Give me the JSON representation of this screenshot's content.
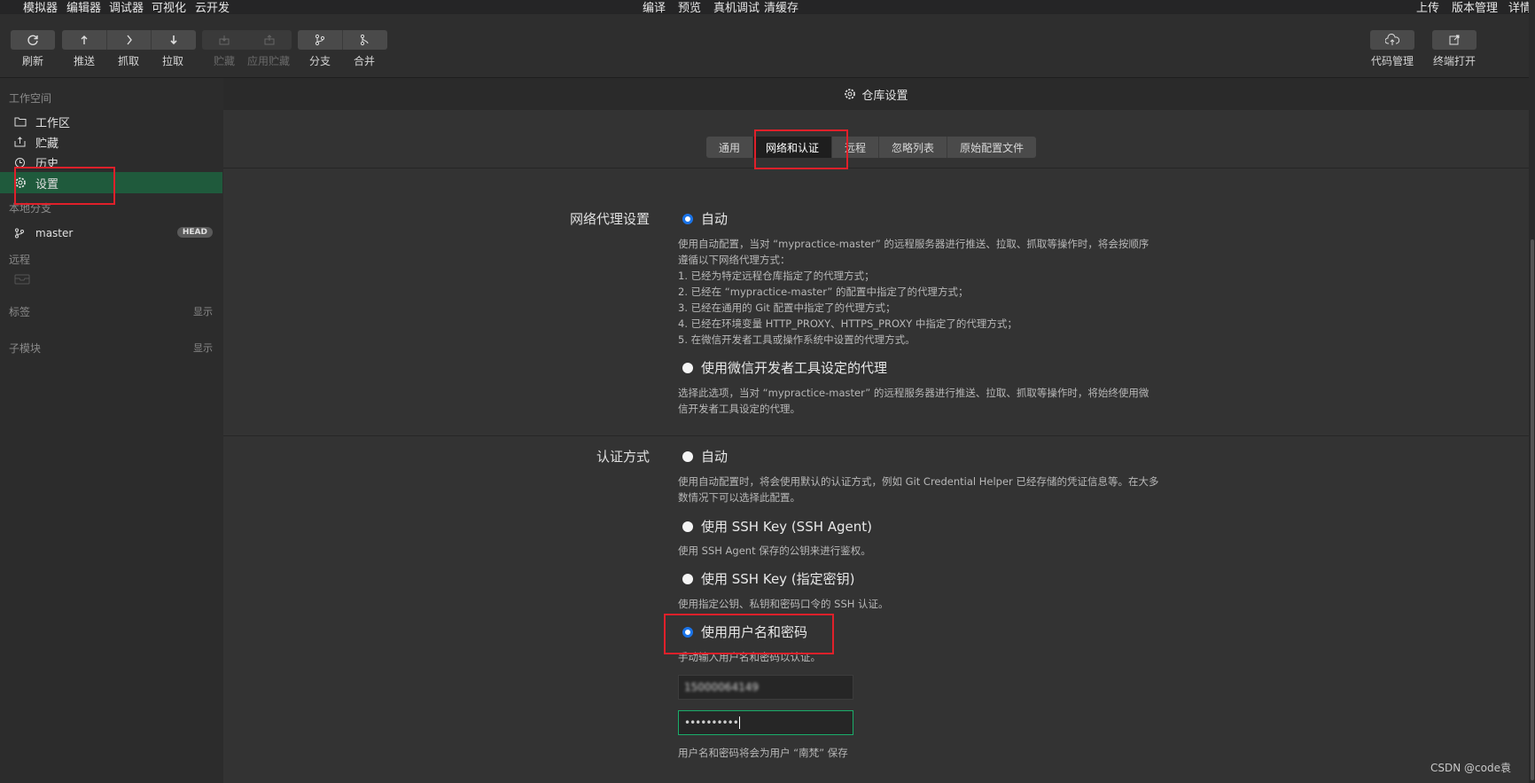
{
  "menubar": {
    "left": [
      "模拟器",
      "编辑器",
      "调试器",
      "可视化",
      "云开发"
    ],
    "center": [
      "编译",
      "预览",
      "真机调试",
      "清缓存"
    ],
    "right": [
      "上传",
      "版本管理",
      "详情"
    ]
  },
  "toolbar": {
    "refresh": "刷新",
    "push": "推送",
    "fetch": "抓取",
    "pull": "拉取",
    "stash": "贮藏",
    "apply_stash": "应用贮藏",
    "branch": "分支",
    "merge": "合并",
    "code_manage": "代码管理",
    "open_terminal": "终端打开"
  },
  "sidebar": {
    "workspace_title": "工作空间",
    "items": [
      "工作区",
      "贮藏",
      "历史",
      "设置"
    ],
    "local_branch_title": "本地分支",
    "branch_name": "master",
    "branch_badge": "HEAD",
    "remote_title": "远程",
    "tags_title": "标签",
    "tags_show": "显示",
    "submodule_title": "子模块",
    "submodule_show": "显示"
  },
  "main": {
    "header_title": "仓库设置",
    "tabs": [
      "通用",
      "网络和认证",
      "远程",
      "忽略列表",
      "原始配置文件"
    ],
    "proxy": {
      "label": "网络代理设置",
      "opt_auto": "自动",
      "auto_desc": [
        "使用自动配置，当对 “mypractice-master” 的远程服务器进行推送、拉取、抓取等操作时，将会按顺序",
        "遵循以下网络代理方式：",
        "1. 已经为特定远程仓库指定了的代理方式；",
        "2. 已经在 “mypractice-master” 的配置中指定了的代理方式；",
        "3. 已经在通用的 Git 配置中指定了的代理方式；",
        "4. 已经在环境变量 HTTP_PROXY、HTTPS_PROXY 中指定了的代理方式；",
        "5. 在微信开发者工具或操作系统中设置的代理方式。"
      ],
      "opt_wechat": "使用微信开发者工具设定的代理",
      "wechat_desc": [
        "选择此选项，当对 “mypractice-master” 的远程服务器进行推送、拉取、抓取等操作时，将始终使用微",
        "信开发者工具设定的代理。"
      ]
    },
    "auth": {
      "label": "认证方式",
      "opt_auto": "自动",
      "auto_desc": [
        "使用自动配置时，将会使用默认的认证方式，例如 Git Credential Helper 已经存储的凭证信息等。在大多",
        "数情况下可以选择此配置。"
      ],
      "opt_ssh_agent": "使用 SSH Key (SSH Agent)",
      "ssh_agent_desc": "使用 SSH Agent 保存的公钥来进行鉴权。",
      "opt_ssh_key": "使用 SSH Key (指定密钥)",
      "ssh_key_desc": "使用指定公钥、私钥和密码口令的 SSH 认证。",
      "opt_userpass": "使用用户名和密码",
      "userpass_desc": "手动输入用户名和密码以认证。",
      "username_value": "15000064149",
      "password_value": "••••••••••",
      "save_note": "用户名和密码将会为用户 “南梵” 保存"
    }
  },
  "watermark": "CSDN @code袁",
  "colors": {
    "accent_green": "#1f5a3c",
    "highlight_red": "#e0202a",
    "radio_blue": "#1a73e8"
  }
}
